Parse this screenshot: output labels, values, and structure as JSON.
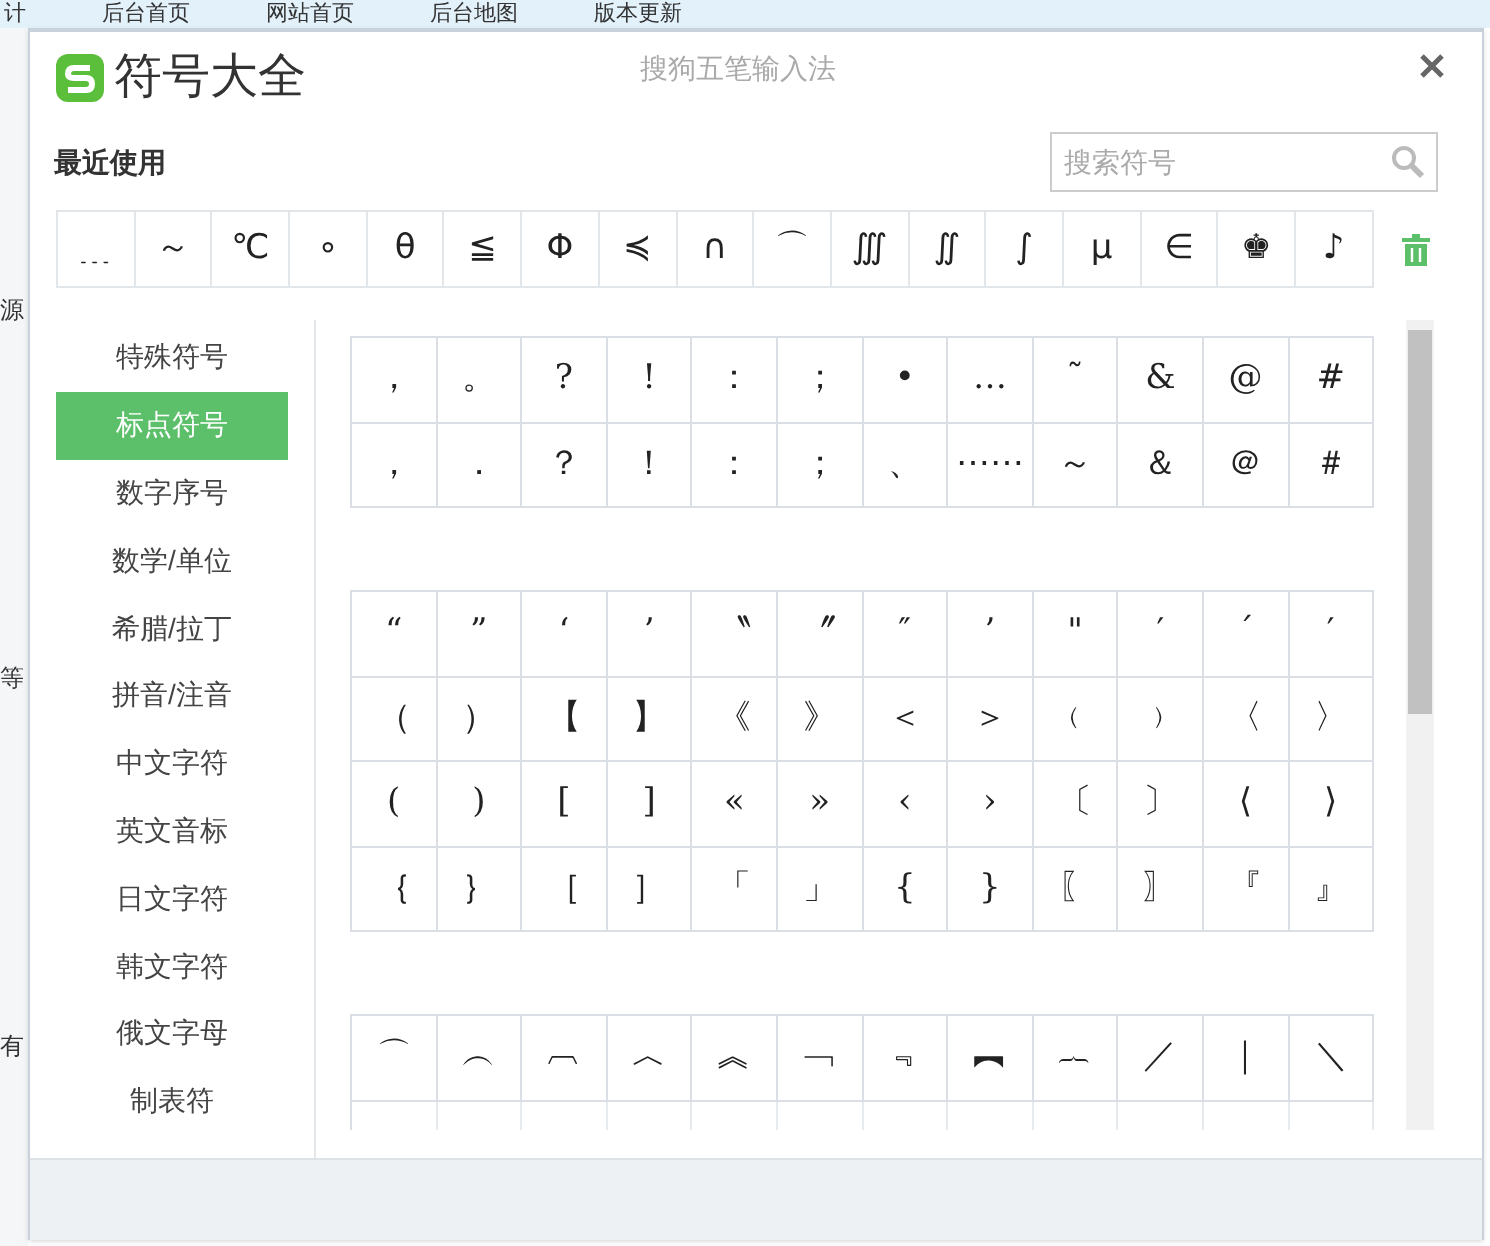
{
  "background": {
    "nav": [
      "计",
      "后台首页",
      "网站首页",
      "后台地图",
      "版本更新"
    ],
    "side_fragments": [
      "源",
      "等",
      "有"
    ]
  },
  "dialog": {
    "title": "符号大全",
    "subtitle": "搜狗五笔输入法",
    "recent_label": "最近使用",
    "search": {
      "placeholder": "搜索符号"
    },
    "recent": [
      "﹍",
      "～",
      "℃",
      "∘",
      "θ",
      "≦",
      "Φ",
      "≼",
      "∩",
      "⌒",
      "∭",
      "∬",
      "∫",
      "μ",
      "∈",
      "♚",
      "♪"
    ],
    "categories": [
      {
        "label": "特殊符号",
        "selected": false
      },
      {
        "label": "标点符号",
        "selected": true
      },
      {
        "label": "数字序号",
        "selected": false
      },
      {
        "label": "数学/单位",
        "selected": false
      },
      {
        "label": "希腊/拉丁",
        "selected": false
      },
      {
        "label": "拼音/注音",
        "selected": false
      },
      {
        "label": "中文字符",
        "selected": false
      },
      {
        "label": "英文音标",
        "selected": false
      },
      {
        "label": "日文字符",
        "selected": false
      },
      {
        "label": "韩文字符",
        "selected": false
      },
      {
        "label": "俄文字母",
        "selected": false
      },
      {
        "label": "制表符",
        "selected": false
      }
    ],
    "groups": [
      {
        "rows": [
          [
            "，",
            "。",
            "?",
            "!",
            "：",
            "；",
            "•",
            "…",
            "˜",
            "&",
            "@",
            "#"
          ],
          [
            "，",
            "．",
            "？",
            "！",
            "：",
            "；",
            "、",
            "⋯⋯",
            "～",
            "＆",
            "＠",
            "＃"
          ]
        ]
      },
      {
        "rows": [
          [
            "“",
            "”",
            "‘",
            "’",
            "〝",
            "〞",
            "″",
            "’",
            "\"",
            "′",
            "´",
            "′"
          ],
          [
            "（",
            "）",
            "【",
            "】",
            "《",
            "》",
            "＜",
            "＞",
            "﹙",
            "﹚",
            "〈",
            "〉"
          ],
          [
            "(",
            ")",
            "[",
            "]",
            "«",
            "»",
            "‹",
            "›",
            "〔",
            "〕",
            "⟨",
            "⟩"
          ],
          [
            "｛",
            "｝",
            "［",
            "］",
            "「",
            "」",
            "{",
            "}",
            "〖",
            "〗",
            "『",
            "』"
          ]
        ]
      },
      {
        "rows": [
          [
            "⌒",
            "︵",
            "︹",
            "︿",
            "︽",
            "﹁",
            "﹃",
            "︻",
            "︷",
            "／",
            "｜",
            "＼"
          ]
        ]
      }
    ]
  }
}
